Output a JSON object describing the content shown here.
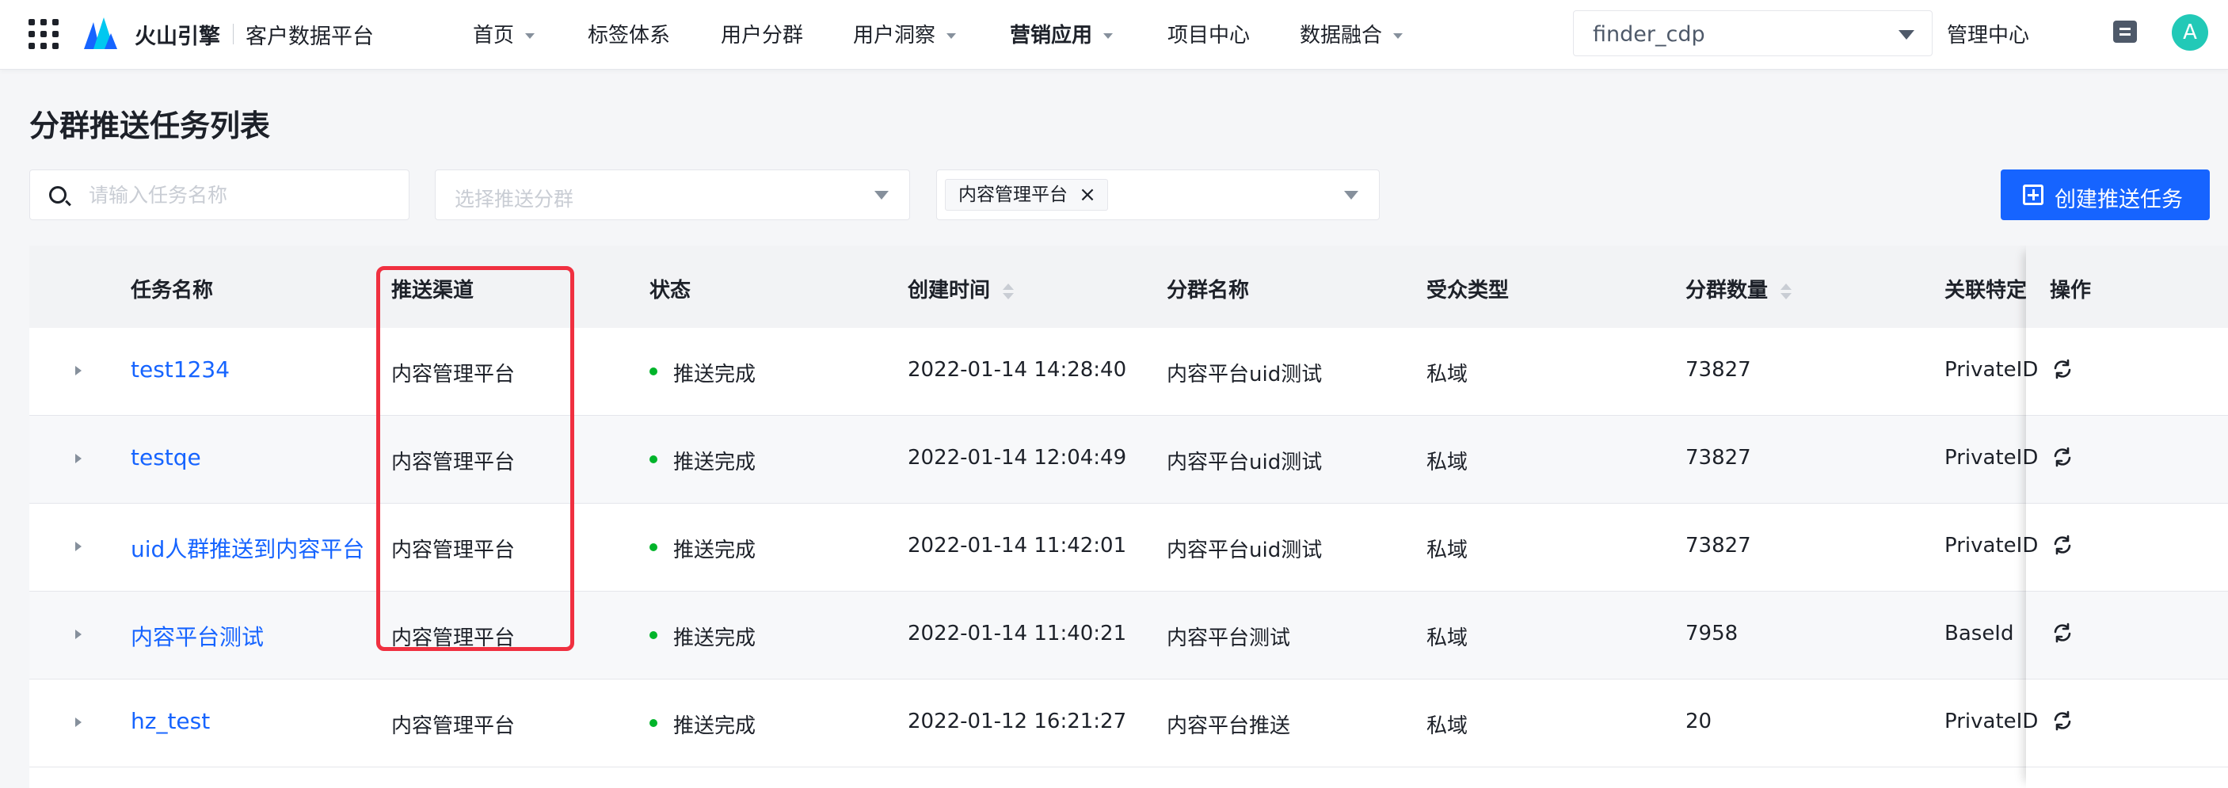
{
  "topbar": {
    "brand": "火山引擎",
    "product": "客户数据平台",
    "nav": [
      {
        "label": "首页",
        "has_caret": true
      },
      {
        "label": "标签体系",
        "has_caret": false
      },
      {
        "label": "用户分群",
        "has_caret": false
      },
      {
        "label": "用户洞察",
        "has_caret": true
      },
      {
        "label": "营销应用",
        "has_caret": true,
        "active": true
      },
      {
        "label": "项目中心",
        "has_caret": false
      },
      {
        "label": "数据融合",
        "has_caret": true
      }
    ],
    "project": "finder_cdp",
    "admin_center": "管理中心",
    "avatar_letter": "A"
  },
  "page": {
    "title": "分群推送任务列表"
  },
  "filters": {
    "search_placeholder": "请输入任务名称",
    "group_placeholder": "选择推送分群",
    "channel_tag": "内容管理平台",
    "tag_close": "×",
    "create_button": "创建推送任务"
  },
  "table": {
    "columns": [
      "任务名称",
      "推送渠道",
      "状态",
      "创建时间",
      "分群名称",
      "受众类型",
      "分群数量",
      "关联特定",
      "操作"
    ],
    "rows": [
      {
        "name": "test1234",
        "channel": "内容管理平台",
        "status": "推送完成",
        "created": "2022-01-14 14:28:40",
        "group": "内容平台uid测试",
        "audience": "私域",
        "count": "73827",
        "related": "PrivateID"
      },
      {
        "name": "testqe",
        "channel": "内容管理平台",
        "status": "推送完成",
        "created": "2022-01-14 12:04:49",
        "group": "内容平台uid测试",
        "audience": "私域",
        "count": "73827",
        "related": "PrivateID"
      },
      {
        "name": "uid人群推送到内容平台",
        "channel": "内容管理平台",
        "status": "推送完成",
        "created": "2022-01-14 11:42:01",
        "group": "内容平台uid测试",
        "audience": "私域",
        "count": "73827",
        "related": "PrivateID"
      },
      {
        "name": "内容平台测试",
        "channel": "内容管理平台",
        "status": "推送完成",
        "created": "2022-01-14 11:40:21",
        "group": "内容平台测试",
        "audience": "私域",
        "count": "7958",
        "related": "BaseId"
      },
      {
        "name": "hz_test",
        "channel": "内容管理平台",
        "status": "推送完成",
        "created": "2022-01-12 16:21:27",
        "group": "内容平台推送",
        "audience": "私域",
        "count": "20",
        "related": "PrivateID"
      }
    ]
  },
  "colors": {
    "accent": "#1664ff",
    "status_success": "#00b42a",
    "highlight_box": "#f03040",
    "avatar_bg": "#22c9b7"
  },
  "icons": {
    "apps": "apps-grid-icon",
    "search": "search-icon",
    "create": "plus-square-icon",
    "row_action": "sync-icon",
    "expand": "caret-right-icon",
    "message": "message-icon"
  }
}
